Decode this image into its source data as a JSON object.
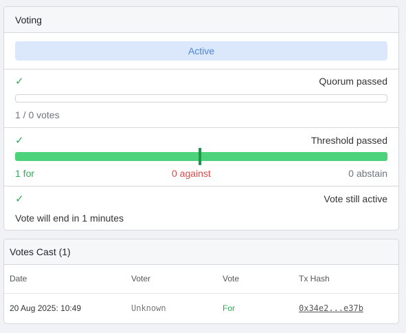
{
  "voting": {
    "header": "Voting",
    "status": "Active",
    "quorum": {
      "check": "✓",
      "label": "Quorum passed",
      "summary": "1 / 0 votes",
      "progress": 0
    },
    "threshold": {
      "check": "✓",
      "label": "Threshold passed",
      "for_label": "1 for",
      "against_label": "0 against",
      "abstain_label": "0 abstain",
      "for_fraction": 1.0,
      "threshold_fraction": 0.5
    },
    "end": {
      "check": "✓",
      "label": "Vote still active",
      "text": "Vote will end in 1 minutes"
    }
  },
  "votes_cast": {
    "header": "Votes Cast (1)",
    "columns": [
      "Date",
      "Voter",
      "Vote",
      "Tx Hash"
    ],
    "rows": [
      {
        "date": "20 Aug 2025: 10:49",
        "voter": "Unknown",
        "vote": "For",
        "tx_hash": "0x34e2...e37b"
      }
    ]
  },
  "colors": {
    "for": "#2eaa56",
    "against": "#e04646",
    "bar": "#4cd27a",
    "status_bg": "#dbe8fc",
    "status_text": "#4b86d6"
  }
}
